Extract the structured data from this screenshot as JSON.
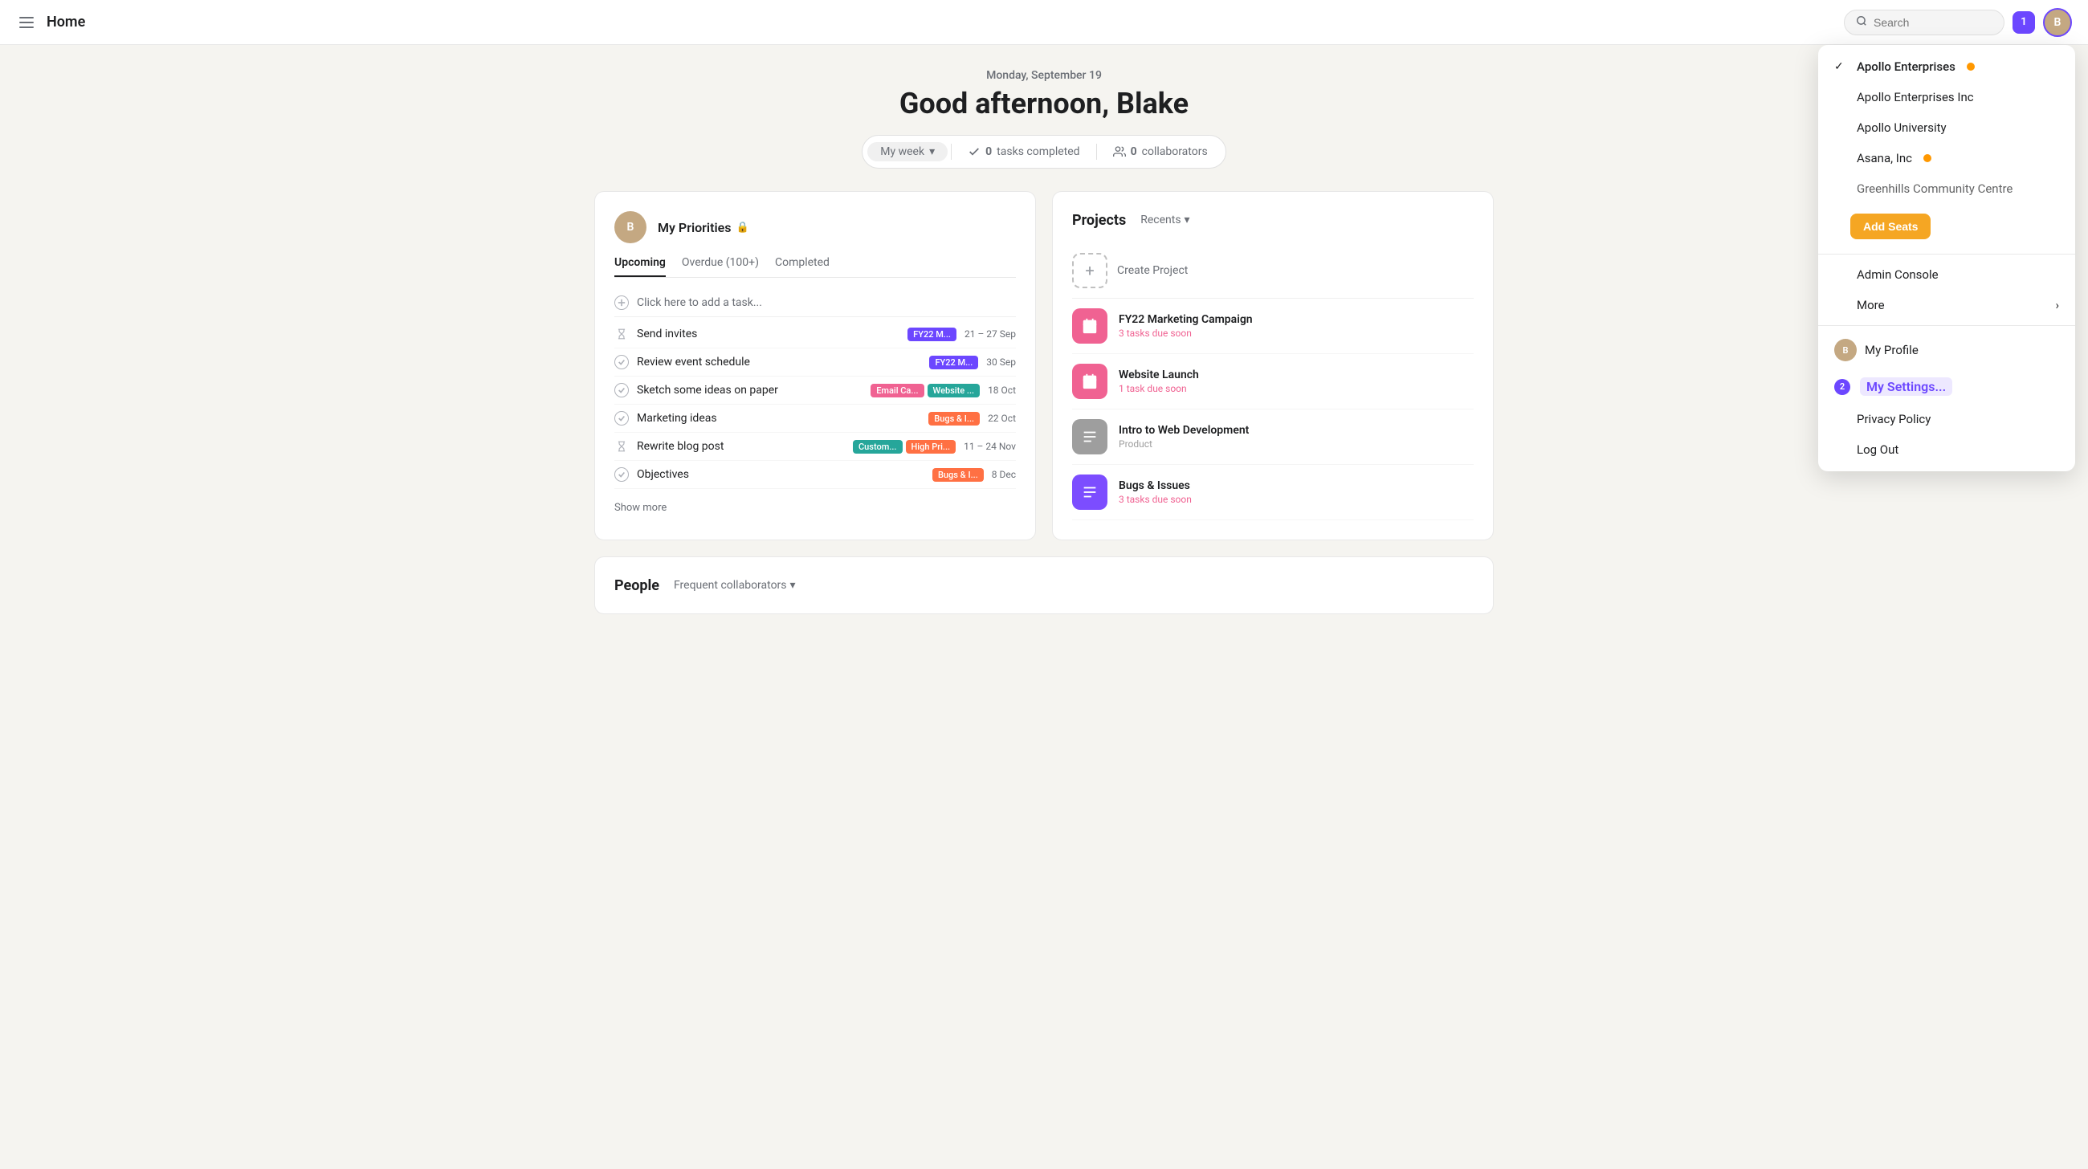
{
  "topnav": {
    "title": "Home",
    "search_placeholder": "Search",
    "notif_count": "1",
    "avatar_initials": "B"
  },
  "hero": {
    "date": "Monday, September 19",
    "greeting": "Good afternoon, Blake",
    "stats": {
      "week_label": "My week",
      "tasks_count": "0",
      "tasks_label": "tasks completed",
      "collaborators_count": "0",
      "collaborators_label": "collaborators"
    }
  },
  "priorities": {
    "title": "My Priorities",
    "tabs": [
      "Upcoming",
      "Overdue (100+)",
      "Completed"
    ],
    "active_tab": "Upcoming",
    "add_placeholder": "Click here to add a task...",
    "tasks": [
      {
        "name": "Send invites",
        "tags": [
          {
            "label": "FY22 M...",
            "color": "purple"
          }
        ],
        "date": "21 – 27 Sep",
        "icon": "hourglass"
      },
      {
        "name": "Review event schedule",
        "tags": [
          {
            "label": "FY22 M...",
            "color": "purple"
          }
        ],
        "date": "30 Sep",
        "icon": "circle-check"
      },
      {
        "name": "Sketch some ideas on paper",
        "tags": [
          {
            "label": "Email Ca...",
            "color": "pink"
          },
          {
            "label": "Website ...",
            "color": "teal"
          }
        ],
        "date": "18 Oct",
        "icon": "circle-check"
      },
      {
        "name": "Marketing ideas",
        "tags": [
          {
            "label": "Bugs & I...",
            "color": "orange"
          }
        ],
        "date": "22 Oct",
        "icon": "circle-check"
      },
      {
        "name": "Rewrite blog post",
        "tags": [
          {
            "label": "Custom...",
            "color": "teal"
          },
          {
            "label": "High Pri...",
            "color": "orange"
          }
        ],
        "date": "11 – 24 Nov",
        "icon": "hourglass"
      },
      {
        "name": "Objectives",
        "tags": [
          {
            "label": "Bugs & I...",
            "color": "orange"
          }
        ],
        "date": "8 Dec",
        "icon": "circle-check"
      }
    ],
    "show_more": "Show more"
  },
  "projects": {
    "title": "Projects",
    "recents_label": "Recents",
    "create_label": "Create Project",
    "items": [
      {
        "name": "FY22 Marketing Campaign",
        "sub": "3 tasks due soon",
        "icon_type": "calendar",
        "color": "pink"
      },
      {
        "name": "Website Launch",
        "sub": "1 task due soon",
        "icon_type": "calendar",
        "color": "pink"
      },
      {
        "name": "Intro to Web Development",
        "sub": "Product",
        "icon_type": "list",
        "color": "gray"
      },
      {
        "name": "Bugs & Issues",
        "sub": "3 tasks due soon",
        "icon_type": "list",
        "color": "purple"
      }
    ]
  },
  "people": {
    "title": "People",
    "collab_label": "Frequent collaborators"
  },
  "dropdown": {
    "orgs": [
      {
        "name": "Apollo Enterprises",
        "dot": "orange",
        "active": true
      },
      {
        "name": "Apollo Enterprises Inc",
        "dot": null,
        "active": false
      },
      {
        "name": "Apollo University",
        "dot": null,
        "active": false
      },
      {
        "name": "Asana, Inc",
        "dot": "orange",
        "active": false
      },
      {
        "name": "Greenhills Community Centre",
        "dot": null,
        "active": false
      }
    ],
    "add_seats_label": "Add Seats",
    "admin_console_label": "Admin Console",
    "more_label": "More",
    "my_profile_label": "My Profile",
    "my_settings_label": "My Settings...",
    "settings_badge": "2",
    "privacy_label": "Privacy Policy",
    "logout_label": "Log Out"
  }
}
